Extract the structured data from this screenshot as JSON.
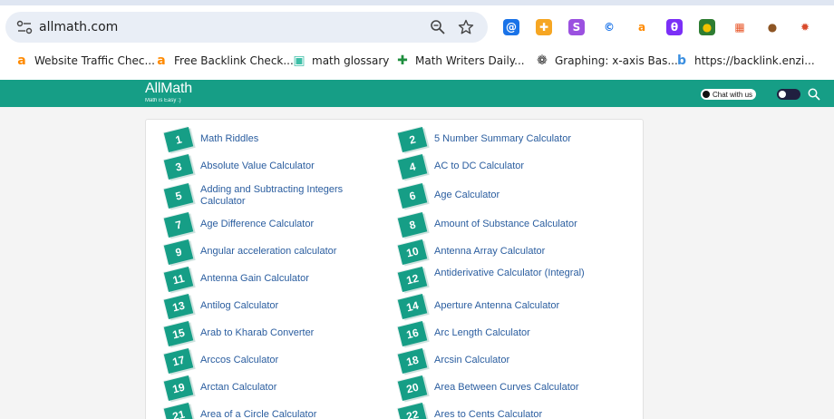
{
  "browser": {
    "url": "allmath.com",
    "extensions": [
      {
        "name": "at-sign-extension-icon",
        "glyph": "@",
        "color": "#1a73e8",
        "text": "#ffffff"
      },
      {
        "name": "flame-extension-icon",
        "glyph": "✚",
        "color": "#f6a623",
        "text": "#ffffff"
      },
      {
        "name": "s-extension-icon",
        "glyph": "S",
        "color": "#9b51e0",
        "text": "#ffffff"
      },
      {
        "name": "copyright-extension-icon",
        "glyph": "©",
        "color": "#ffffff",
        "text": "#1a73e8"
      },
      {
        "name": "a-extension-icon",
        "glyph": "a",
        "color": "#ffffff",
        "text": "#ff8a00"
      },
      {
        "name": "purple-extension-icon",
        "glyph": "θ",
        "color": "#7b2ff7",
        "text": "#ffffff"
      },
      {
        "name": "globe-extension-icon",
        "glyph": "●",
        "color": "#2e7d32",
        "text": "#f2c200"
      },
      {
        "name": "layout-extension-icon",
        "glyph": "▦",
        "color": "#ffffff",
        "text": "#e8572a"
      },
      {
        "name": "cookie-extension-icon",
        "glyph": "●",
        "color": "#ffffff",
        "text": "#8d5524"
      },
      {
        "name": "crab-extension-icon",
        "glyph": "✹",
        "color": "#ffffff",
        "text": "#d94a2b"
      }
    ],
    "bookmarks": [
      {
        "label": "Website Traffic Chec...",
        "icon": "a-bookmark-icon",
        "glyph": "a",
        "color": "#ff8a00"
      },
      {
        "label": "Free Backlink Check...",
        "icon": "a-bookmark-icon",
        "glyph": "a",
        "color": "#ff8a00"
      },
      {
        "label": "math glossary",
        "icon": "cube-bookmark-icon",
        "glyph": "▣",
        "color": "#3dbfa7"
      },
      {
        "label": "Math Writers Daily...",
        "icon": "sheets-bookmark-icon",
        "glyph": "✚",
        "color": "#1e8e3e"
      },
      {
        "label": "Graphing: x-axis Bas...",
        "icon": "openai-bookmark-icon",
        "glyph": "❁",
        "color": "#333333"
      },
      {
        "label": "https://backlink.enzi...",
        "icon": "b-bookmark-icon",
        "glyph": "b",
        "color": "#3b8fe0"
      }
    ]
  },
  "site": {
    "name": "AllMath",
    "tagline": "Math is Easy :)",
    "chat_label": "Chat with us",
    "brand_color": "#169e86"
  },
  "calculators": [
    {
      "num": "1",
      "label": "Math Riddles"
    },
    {
      "num": "2",
      "label": "5 Number Summary Calculator"
    },
    {
      "num": "3",
      "label": "Absolute Value Calculator"
    },
    {
      "num": "4",
      "label": "AC to DC Calculator"
    },
    {
      "num": "5",
      "label": "Adding and Subtracting Integers Calculator"
    },
    {
      "num": "6",
      "label": "Age Calculator"
    },
    {
      "num": "7",
      "label": "Age Difference Calculator"
    },
    {
      "num": "8",
      "label": "Amount of Substance Calculator"
    },
    {
      "num": "9",
      "label": "Angular acceleration calculator"
    },
    {
      "num": "10",
      "label": "Antenna Array Calculator"
    },
    {
      "num": "11",
      "label": "Antenna Gain Calculator"
    },
    {
      "num": "12",
      "label": "Antiderivative Calculator (Integral)"
    },
    {
      "num": "13",
      "label": "Antilog Calculator"
    },
    {
      "num": "14",
      "label": "Aperture Antenna Calculator"
    },
    {
      "num": "15",
      "label": "Arab to Kharab Converter"
    },
    {
      "num": "16",
      "label": "Arc Length Calculator"
    },
    {
      "num": "17",
      "label": "Arccos Calculator"
    },
    {
      "num": "18",
      "label": "Arcsin Calculator"
    },
    {
      "num": "19",
      "label": "Arctan Calculator"
    },
    {
      "num": "20",
      "label": "Area Between Curves Calculator"
    },
    {
      "num": "21",
      "label": "Area of a Circle Calculator"
    },
    {
      "num": "22",
      "label": "Ares to Cents Calculator"
    }
  ]
}
